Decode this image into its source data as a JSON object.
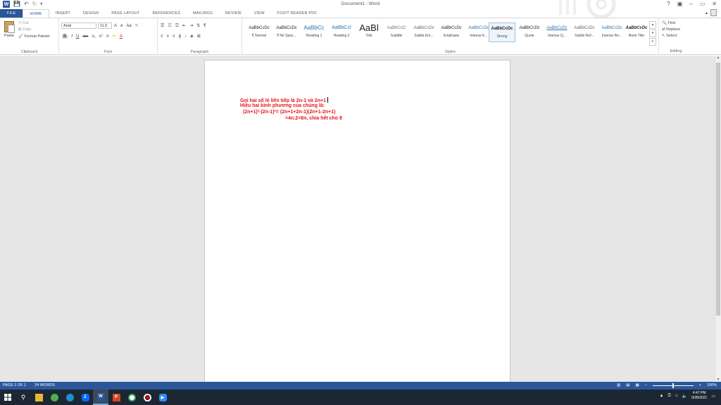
{
  "window": {
    "title": "Document1 - Word",
    "controls": [
      "?",
      "▣",
      "–",
      "▭",
      "✕"
    ]
  },
  "tabs": [
    {
      "label": "FILE"
    },
    {
      "label": "HOME"
    },
    {
      "label": "INSERT"
    },
    {
      "label": "DESIGN"
    },
    {
      "label": "PAGE LAYOUT"
    },
    {
      "label": "REFERENCES"
    },
    {
      "label": "MAILINGS"
    },
    {
      "label": "REVIEW"
    },
    {
      "label": "VIEW"
    },
    {
      "label": "FOXIT READER PDF"
    }
  ],
  "clipboard": {
    "paste": "Paste",
    "cut": "Cut",
    "copy": "Copy",
    "format_painter": "Format Painter",
    "label": "Clipboard"
  },
  "font": {
    "name": "Arial",
    "size": "11.5",
    "grow": "A",
    "shrink": "A",
    "case": "Aa",
    "bold": "B",
    "italic": "I",
    "underline": "U",
    "strike": "abc",
    "subscript": "x₂",
    "superscript": "x²",
    "label": "Font"
  },
  "paragraph": {
    "label": "Paragraph"
  },
  "styles": {
    "label": "Styles",
    "items": [
      {
        "sample": "AaBbCcDc",
        "name": "¶ Normal"
      },
      {
        "sample": "AaBbCcDc",
        "name": "¶ No Spac..."
      },
      {
        "sample": "AaBbCc",
        "name": "Heading 1"
      },
      {
        "sample": "AaBbCcI",
        "name": "Heading 2"
      },
      {
        "sample": "AaBl",
        "name": "Title"
      },
      {
        "sample": "AaBbCcD",
        "name": "Subtitle"
      },
      {
        "sample": "AaBbCcDc",
        "name": "Subtle Em..."
      },
      {
        "sample": "AaBbCcDc",
        "name": "Emphasis"
      },
      {
        "sample": "AaBbCcDc",
        "name": "Intense E..."
      },
      {
        "sample": "AaBbCcDc",
        "name": "Strong"
      },
      {
        "sample": "AaBbCcDc",
        "name": "Quote"
      },
      {
        "sample": "AaBbCcDc",
        "name": "Intense Q..."
      },
      {
        "sample": "AaBbCcDc",
        "name": "Subtle Ref..."
      },
      {
        "sample": "AaBbCcDc",
        "name": "Intense Re..."
      },
      {
        "sample": "AaBbCcDc",
        "name": "Book Title"
      }
    ]
  },
  "editing": {
    "find": "Find",
    "replace": "Replace",
    "select": "Select",
    "label": "Editing"
  },
  "document": {
    "lines": [
      "Gọi hai số lẻ liên tiếp là 2n-1 và 2n+1",
      "Hiệu hai bình phương của chúng là:",
      "(2n+1)²-(2n-1)²= (2n+1+2n-1)(2n+1-2n+1)",
      "=4n.2=8n, chia hết cho 8"
    ],
    "text_color": "#e8141a"
  },
  "status": {
    "page": "PAGE 1 OF 1",
    "words": "24 WORDS",
    "zoom": "100%",
    "zoom_minus": "–",
    "zoom_plus": "+"
  },
  "taskbar": {
    "time": "4:47 PM",
    "date": "9/28/2021"
  },
  "colors": {
    "accent": "#2b579a",
    "taskbar": "#1c2733",
    "doc_bg": "#e6e6e6"
  }
}
